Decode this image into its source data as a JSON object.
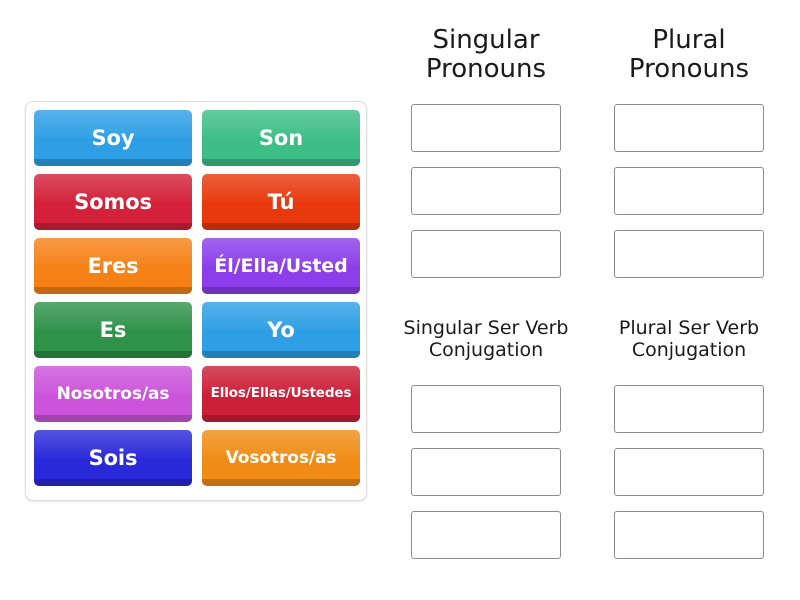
{
  "activity": {
    "type": "group-sort",
    "tile_panel": {
      "name": "word-tile-tray",
      "tiles": [
        {
          "label": "Soy",
          "color": "#2E9FE5",
          "size": "lg"
        },
        {
          "label": "Son",
          "color": "#3DBE87",
          "size": "lg"
        },
        {
          "label": "Somos",
          "color": "#D32139",
          "size": "lg"
        },
        {
          "label": "Tú",
          "color": "#E8380D",
          "size": "lg"
        },
        {
          "label": "Eres",
          "color": "#F58117",
          "size": "lg"
        },
        {
          "label": "Él/Ella/Usted",
          "color": "#8B3EEA",
          "size": "md"
        },
        {
          "label": "Es",
          "color": "#2E9249",
          "size": "lg"
        },
        {
          "label": "Yo",
          "color": "#2E9FE5",
          "size": "lg"
        },
        {
          "label": "Nosotros/as",
          "color": "#CC54DB",
          "size": "sm"
        },
        {
          "label": "Ellos/Ellas/Ustedes",
          "color": "#CC1F38",
          "size": "xs"
        },
        {
          "label": "Sois",
          "color": "#2929D8",
          "size": "lg"
        },
        {
          "label": "Vosotros/as",
          "color": "#F08C15",
          "size": "sm"
        }
      ]
    },
    "groups": [
      {
        "title": "Singular\nPronouns",
        "slots": [
          "",
          "",
          ""
        ]
      },
      {
        "title": "Plural\nPronouns",
        "slots": [
          "",
          "",
          ""
        ]
      },
      {
        "title": "Singular Ser Verb\nConjugation",
        "slots": [
          "",
          "",
          ""
        ]
      },
      {
        "title": "Plural Ser Verb\nConjugation",
        "slots": [
          "",
          "",
          ""
        ]
      }
    ]
  },
  "colors": {
    "page_background": "#FFFFFF",
    "panel_border": "#DDDDDD",
    "dropzone_border": "#8D8D8D",
    "heading_text": "#1A1A1A",
    "tile_text": "#FFFFFF"
  }
}
